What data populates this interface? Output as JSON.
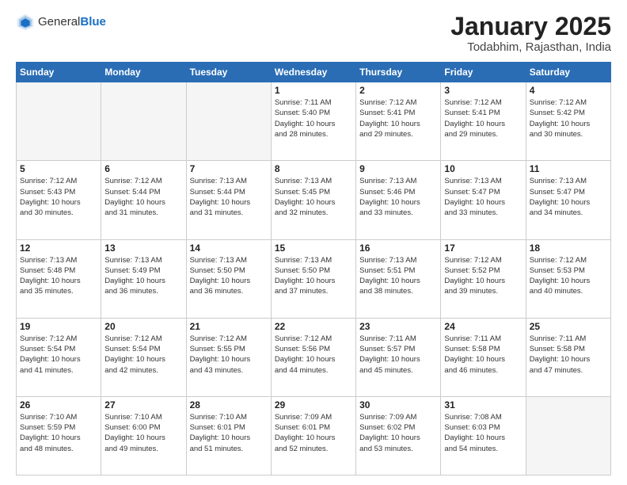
{
  "header": {
    "logo_general": "General",
    "logo_blue": "Blue",
    "title": "January 2025",
    "subtitle": "Todabhim, Rajasthan, India"
  },
  "weekdays": [
    "Sunday",
    "Monday",
    "Tuesday",
    "Wednesday",
    "Thursday",
    "Friday",
    "Saturday"
  ],
  "weeks": [
    [
      {
        "day": "",
        "info": ""
      },
      {
        "day": "",
        "info": ""
      },
      {
        "day": "",
        "info": ""
      },
      {
        "day": "1",
        "info": "Sunrise: 7:11 AM\nSunset: 5:40 PM\nDaylight: 10 hours\nand 28 minutes."
      },
      {
        "day": "2",
        "info": "Sunrise: 7:12 AM\nSunset: 5:41 PM\nDaylight: 10 hours\nand 29 minutes."
      },
      {
        "day": "3",
        "info": "Sunrise: 7:12 AM\nSunset: 5:41 PM\nDaylight: 10 hours\nand 29 minutes."
      },
      {
        "day": "4",
        "info": "Sunrise: 7:12 AM\nSunset: 5:42 PM\nDaylight: 10 hours\nand 30 minutes."
      }
    ],
    [
      {
        "day": "5",
        "info": "Sunrise: 7:12 AM\nSunset: 5:43 PM\nDaylight: 10 hours\nand 30 minutes."
      },
      {
        "day": "6",
        "info": "Sunrise: 7:12 AM\nSunset: 5:44 PM\nDaylight: 10 hours\nand 31 minutes."
      },
      {
        "day": "7",
        "info": "Sunrise: 7:13 AM\nSunset: 5:44 PM\nDaylight: 10 hours\nand 31 minutes."
      },
      {
        "day": "8",
        "info": "Sunrise: 7:13 AM\nSunset: 5:45 PM\nDaylight: 10 hours\nand 32 minutes."
      },
      {
        "day": "9",
        "info": "Sunrise: 7:13 AM\nSunset: 5:46 PM\nDaylight: 10 hours\nand 33 minutes."
      },
      {
        "day": "10",
        "info": "Sunrise: 7:13 AM\nSunset: 5:47 PM\nDaylight: 10 hours\nand 33 minutes."
      },
      {
        "day": "11",
        "info": "Sunrise: 7:13 AM\nSunset: 5:47 PM\nDaylight: 10 hours\nand 34 minutes."
      }
    ],
    [
      {
        "day": "12",
        "info": "Sunrise: 7:13 AM\nSunset: 5:48 PM\nDaylight: 10 hours\nand 35 minutes."
      },
      {
        "day": "13",
        "info": "Sunrise: 7:13 AM\nSunset: 5:49 PM\nDaylight: 10 hours\nand 36 minutes."
      },
      {
        "day": "14",
        "info": "Sunrise: 7:13 AM\nSunset: 5:50 PM\nDaylight: 10 hours\nand 36 minutes."
      },
      {
        "day": "15",
        "info": "Sunrise: 7:13 AM\nSunset: 5:50 PM\nDaylight: 10 hours\nand 37 minutes."
      },
      {
        "day": "16",
        "info": "Sunrise: 7:13 AM\nSunset: 5:51 PM\nDaylight: 10 hours\nand 38 minutes."
      },
      {
        "day": "17",
        "info": "Sunrise: 7:12 AM\nSunset: 5:52 PM\nDaylight: 10 hours\nand 39 minutes."
      },
      {
        "day": "18",
        "info": "Sunrise: 7:12 AM\nSunset: 5:53 PM\nDaylight: 10 hours\nand 40 minutes."
      }
    ],
    [
      {
        "day": "19",
        "info": "Sunrise: 7:12 AM\nSunset: 5:54 PM\nDaylight: 10 hours\nand 41 minutes."
      },
      {
        "day": "20",
        "info": "Sunrise: 7:12 AM\nSunset: 5:54 PM\nDaylight: 10 hours\nand 42 minutes."
      },
      {
        "day": "21",
        "info": "Sunrise: 7:12 AM\nSunset: 5:55 PM\nDaylight: 10 hours\nand 43 minutes."
      },
      {
        "day": "22",
        "info": "Sunrise: 7:12 AM\nSunset: 5:56 PM\nDaylight: 10 hours\nand 44 minutes."
      },
      {
        "day": "23",
        "info": "Sunrise: 7:11 AM\nSunset: 5:57 PM\nDaylight: 10 hours\nand 45 minutes."
      },
      {
        "day": "24",
        "info": "Sunrise: 7:11 AM\nSunset: 5:58 PM\nDaylight: 10 hours\nand 46 minutes."
      },
      {
        "day": "25",
        "info": "Sunrise: 7:11 AM\nSunset: 5:58 PM\nDaylight: 10 hours\nand 47 minutes."
      }
    ],
    [
      {
        "day": "26",
        "info": "Sunrise: 7:10 AM\nSunset: 5:59 PM\nDaylight: 10 hours\nand 48 minutes."
      },
      {
        "day": "27",
        "info": "Sunrise: 7:10 AM\nSunset: 6:00 PM\nDaylight: 10 hours\nand 49 minutes."
      },
      {
        "day": "28",
        "info": "Sunrise: 7:10 AM\nSunset: 6:01 PM\nDaylight: 10 hours\nand 51 minutes."
      },
      {
        "day": "29",
        "info": "Sunrise: 7:09 AM\nSunset: 6:01 PM\nDaylight: 10 hours\nand 52 minutes."
      },
      {
        "day": "30",
        "info": "Sunrise: 7:09 AM\nSunset: 6:02 PM\nDaylight: 10 hours\nand 53 minutes."
      },
      {
        "day": "31",
        "info": "Sunrise: 7:08 AM\nSunset: 6:03 PM\nDaylight: 10 hours\nand 54 minutes."
      },
      {
        "day": "",
        "info": ""
      }
    ]
  ]
}
